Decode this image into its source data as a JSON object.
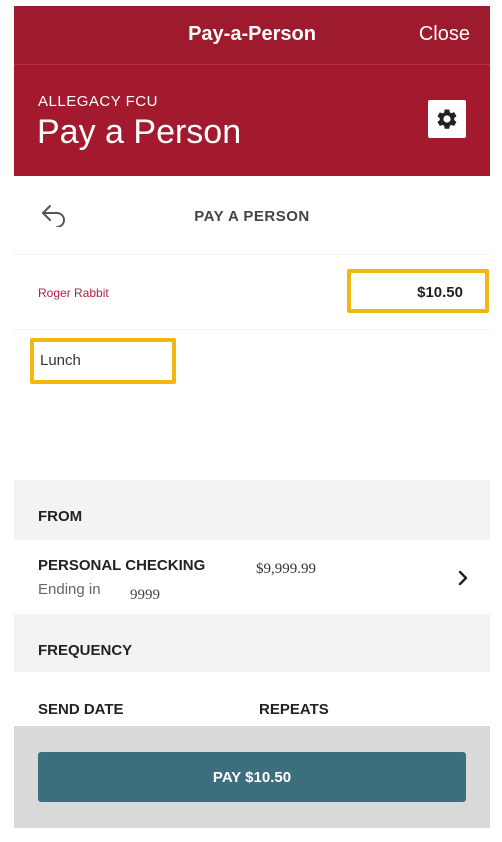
{
  "topbar": {
    "title": "Pay-a-Person",
    "close_label": "Close"
  },
  "header": {
    "org": "ALLEGACY FCU",
    "heading": "Pay a Person"
  },
  "nav": {
    "title": "PAY A PERSON"
  },
  "payment": {
    "payee": "Roger Rabbit",
    "amount": "$10.50",
    "memo": "Lunch"
  },
  "from": {
    "section_label": "FROM",
    "account_name": "PERSONAL CHECKING",
    "ending_label": "Ending in",
    "ending_digits": "9999",
    "balance": "$9,999.99"
  },
  "frequency": {
    "section_label": "FREQUENCY",
    "send_date_label": "SEND DATE",
    "repeats_label": "REPEATS"
  },
  "footer": {
    "pay_button": "PAY $10.50"
  },
  "colors": {
    "brand_red": "#a3192e",
    "highlight": "#f2b80f",
    "button_teal": "#3d6e7e",
    "payee_text": "#b52140"
  }
}
